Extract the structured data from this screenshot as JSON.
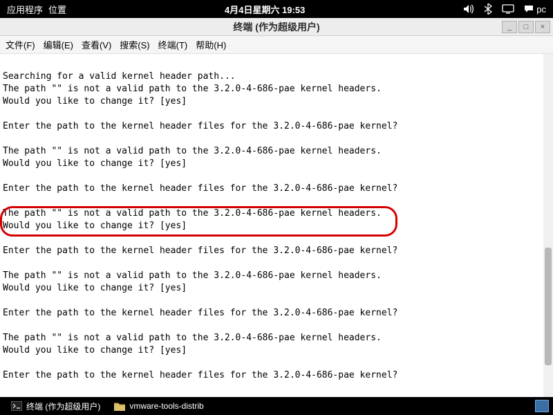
{
  "top_panel": {
    "apps": "应用程序",
    "places": "位置",
    "datetime": "4月4日星期六 19:53",
    "pc": "pc"
  },
  "window": {
    "title": "终端 (作为超级用户)",
    "min": "_",
    "max": "□",
    "close": "×"
  },
  "menu": {
    "file": "文件(F)",
    "edit": "编辑(E)",
    "view": "查看(V)",
    "search": "搜索(S)",
    "terminal": "终端(T)",
    "help": "帮助(H)"
  },
  "terminal": {
    "lines": [
      "",
      "Searching for a valid kernel header path...",
      "The path \"\" is not a valid path to the 3.2.0-4-686-pae kernel headers.",
      "Would you like to change it? [yes]",
      "",
      "Enter the path to the kernel header files for the 3.2.0-4-686-pae kernel?",
      "",
      "The path \"\" is not a valid path to the 3.2.0-4-686-pae kernel headers.",
      "Would you like to change it? [yes]",
      "",
      "Enter the path to the kernel header files for the 3.2.0-4-686-pae kernel?",
      "",
      "The path \"\" is not a valid path to the 3.2.0-4-686-pae kernel headers.",
      "Would you like to change it? [yes]",
      "",
      "Enter the path to the kernel header files for the 3.2.0-4-686-pae kernel?",
      "",
      "The path \"\" is not a valid path to the 3.2.0-4-686-pae kernel headers.",
      "Would you like to change it? [yes]",
      "",
      "Enter the path to the kernel header files for the 3.2.0-4-686-pae kernel?",
      "",
      "The path \"\" is not a valid path to the 3.2.0-4-686-pae kernel headers.",
      "Would you like to change it? [yes]",
      "",
      "Enter the path to the kernel header files for the 3.2.0-4-686-pae kernel?"
    ]
  },
  "bottom": {
    "task1": "终端 (作为超级用户)",
    "task2": "vmware-tools-distrib"
  }
}
